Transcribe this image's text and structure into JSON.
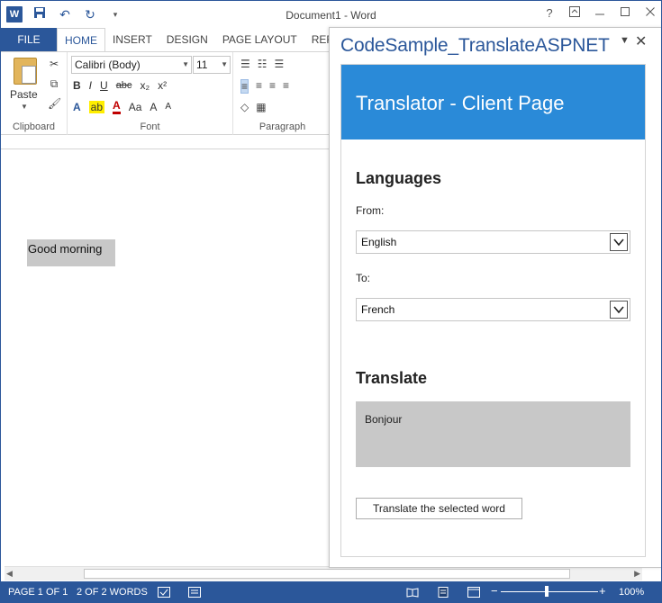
{
  "titlebar": {
    "title": "Document1 - Word",
    "help": "?",
    "qat_undo": "↶",
    "qat_redo": "↻",
    "qat_custom": "▾"
  },
  "tabs": [
    "FILE",
    "HOME",
    "INSERT",
    "DESIGN",
    "PAGE LAYOUT",
    "REFE"
  ],
  "ribbon": {
    "clipboard": {
      "paste_label": "Paste",
      "group_label": "Clipboard"
    },
    "font": {
      "font_name": "Calibri (Body)",
      "font_size": "11",
      "group_label": "Font",
      "bold": "B",
      "italic": "I",
      "underline": "U",
      "strike": "abc",
      "subscript": "x₂",
      "superscript": "x²",
      "change_case": "Aa",
      "grow": "A",
      "shrink": "A"
    },
    "paragraph": {
      "group_label": "Paragraph"
    }
  },
  "document": {
    "selected_text": "Good morning"
  },
  "statusbar": {
    "page": "PAGE 1 OF 1",
    "words": "2 OF 2 WORDS",
    "zoom": "100%",
    "zoom_minus": "−",
    "zoom_plus": "+"
  },
  "taskpane": {
    "title": "CodeSample_TranslateASPNET",
    "banner": "Translator - Client Page",
    "languages_heading": "Languages",
    "from_label": "From:",
    "from_value": "English",
    "to_label": "To:",
    "to_value": "French",
    "translate_heading": "Translate",
    "output_text": "Bonjour",
    "button_label": "Translate the selected word"
  },
  "colors": {
    "word_blue": "#2b579a",
    "banner_blue": "#2a8ad8",
    "selection_gray": "#c8c8c8"
  }
}
